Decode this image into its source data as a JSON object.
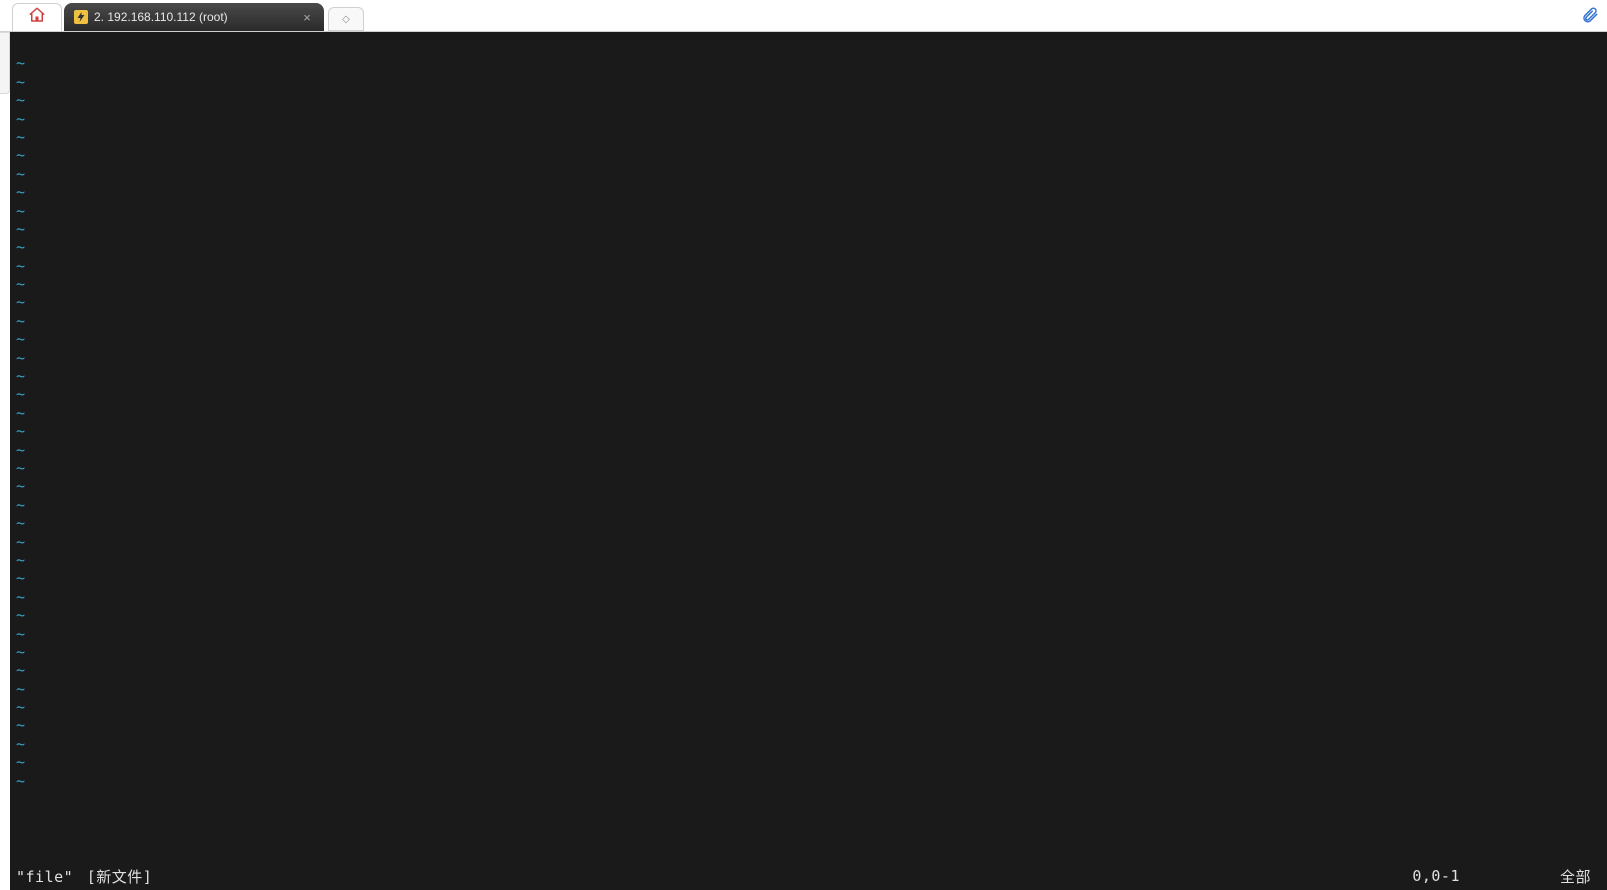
{
  "tabs": {
    "session": {
      "title": "2. 192.168.110.112 (root)"
    },
    "new_tab_glyph": "◇"
  },
  "terminal": {
    "tilde": "~",
    "empty_lines_before_tildes": 1,
    "tilde_count": 40
  },
  "status": {
    "filename": "\"file\"",
    "newfile_label": "[新文件]",
    "position": "0,0-1",
    "scroll": "全部"
  }
}
